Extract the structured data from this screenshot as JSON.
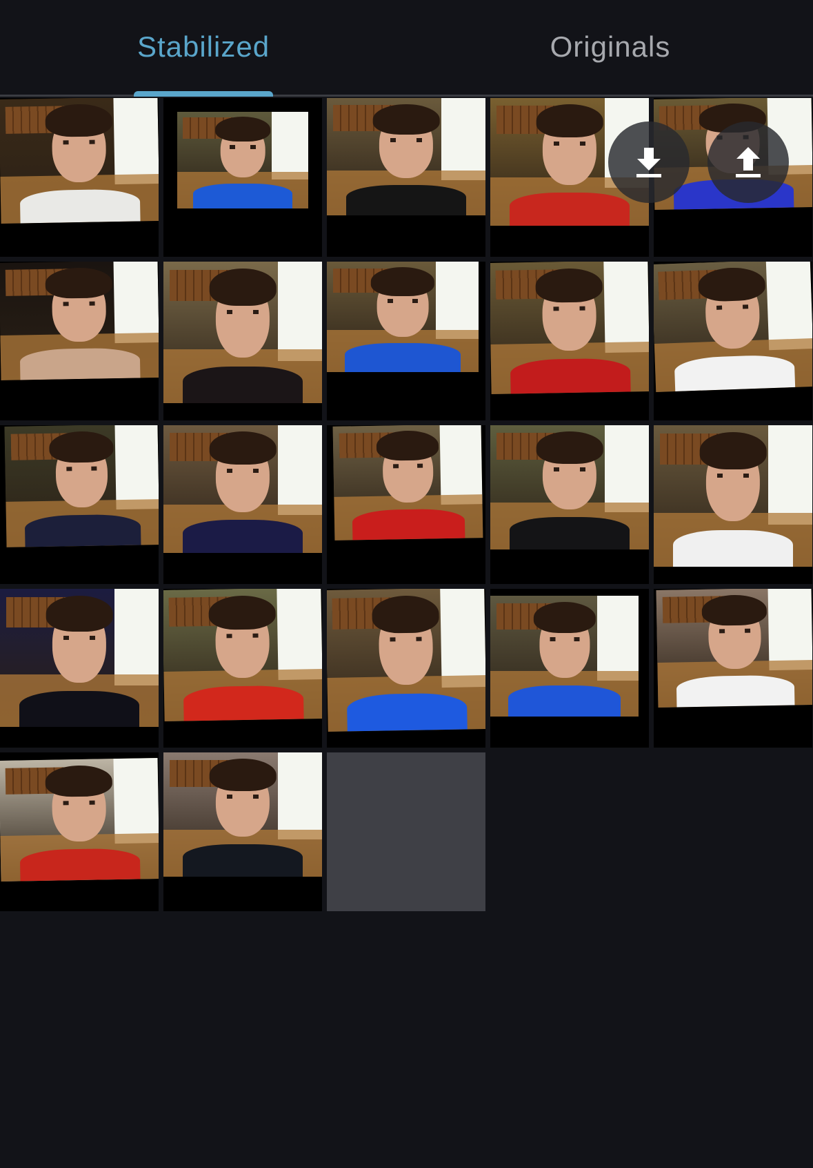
{
  "tabs": [
    {
      "label": "Stabilized",
      "active": true
    },
    {
      "label": "Originals",
      "active": false
    }
  ],
  "colors": {
    "background": "#121318",
    "accent": "#5aa6cb",
    "inactive_tab": "#a7a9ae",
    "empty_cell": "#3f4046"
  },
  "actions": {
    "download_icon": "download-icon",
    "upload_icon": "upload-icon"
  },
  "photos": [
    {
      "shirt": "#e9e9e6",
      "light": "#3a2a18"
    },
    {
      "shirt": "#1d5ad6",
      "light": "#5e5a3c"
    },
    {
      "shirt": "#151515",
      "light": "#6a5a3c"
    },
    {
      "shirt": "#c8271e",
      "light": "#7a6030"
    },
    {
      "shirt": "#2a36c9",
      "light": "#6a5a34"
    },
    {
      "shirt": "#c9a58a",
      "light": "#1a1410"
    },
    {
      "shirt": "#1b1517",
      "light": "#7a6a4a"
    },
    {
      "shirt": "#1e56d2",
      "light": "#6a5a3a"
    },
    {
      "shirt": "#c21c1c",
      "light": "#6a5a36"
    },
    {
      "shirt": "#f2f2f2",
      "light": "#6a5e42"
    },
    {
      "shirt": "#1c1f3a",
      "light": "#3c3a26"
    },
    {
      "shirt": "#1b1b46",
      "light": "#6e5a40"
    },
    {
      "shirt": "#c91e1c",
      "light": "#6e6044"
    },
    {
      "shirt": "#141416",
      "light": "#5e5e3e"
    },
    {
      "shirt": "#f0f0f0",
      "light": "#6a5a3e"
    },
    {
      "shirt": "#101018",
      "light": "#1c1c40"
    },
    {
      "shirt": "#d2281c",
      "light": "#6a6a46"
    },
    {
      "shirt": "#1e5ae0",
      "light": "#6e5a3c"
    },
    {
      "shirt": "#1f56d8",
      "light": "#5e5840"
    },
    {
      "shirt": "#f2f2f2",
      "light": "#8a7666"
    },
    {
      "shirt": "#c8261c",
      "light": "#bdb5a5"
    },
    {
      "shirt": "#141820",
      "light": "#8a7a70"
    },
    {
      "empty": true
    }
  ]
}
